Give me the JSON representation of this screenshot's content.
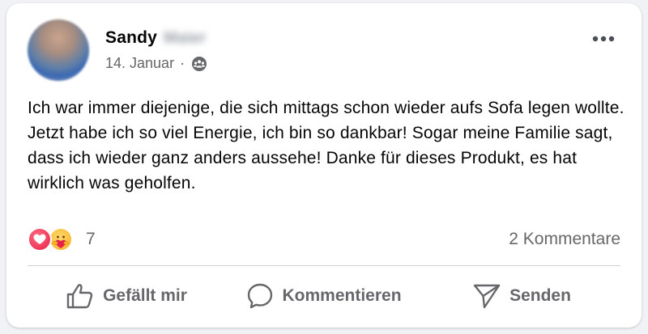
{
  "post": {
    "author_first_name": "Sandy",
    "author_last_name_blurred": "Maier",
    "date": "14. Januar",
    "separator": "·",
    "audience_icon": "friends-icon",
    "text": "Ich war immer diejenige, die sich mittags schon wieder aufs Sofa legen wollte. Jetzt habe ich so viel Energie, ich bin so dankbar! Sogar meine Familie sagt, dass ich wieder ganz anders aussehe! Danke für dieses Produkt, es hat wirklich was geholfen.",
    "more_icon": "more-horizontal-icon"
  },
  "stats": {
    "reactions": [
      "love",
      "care"
    ],
    "reaction_count": "7",
    "comments_label": "2 Kommentare"
  },
  "actions": {
    "like_label": "Gefällt mir",
    "comment_label": "Kommentieren",
    "send_label": "Senden"
  },
  "colors": {
    "secondary_text": "#65676b",
    "love": "#e8224b",
    "care": "#f7b125",
    "divider": "#ced0d4"
  }
}
